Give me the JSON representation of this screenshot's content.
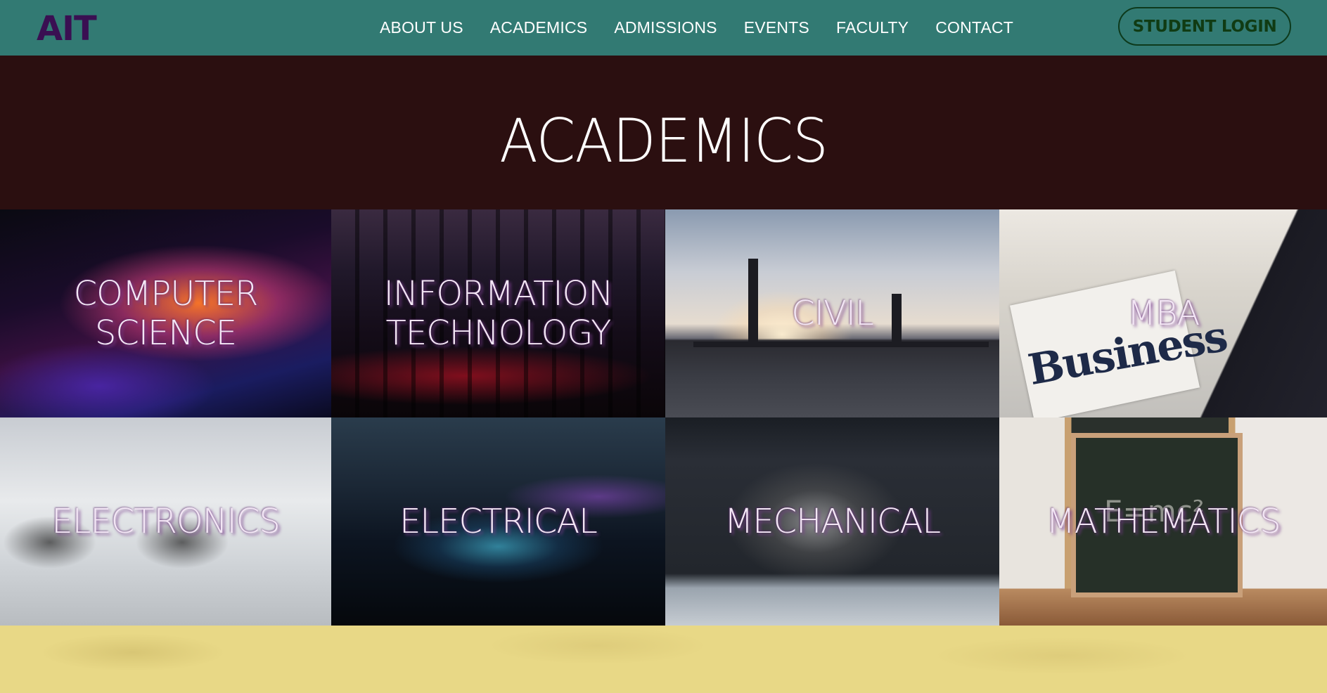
{
  "brand": {
    "logo_text": "AIT"
  },
  "nav": {
    "items": [
      {
        "label": "ABOUT US"
      },
      {
        "label": "ACADEMICS"
      },
      {
        "label": "ADMISSIONS"
      },
      {
        "label": "EVENTS"
      },
      {
        "label": "FACULTY"
      },
      {
        "label": "CONTACT"
      }
    ],
    "login_label": "STUDENT LOGIN"
  },
  "hero": {
    "title": "ACADEMICS"
  },
  "tiles": [
    {
      "label": "COMPUTER\nSCIENCE"
    },
    {
      "label": "INFORMATION\nTECHNOLOGY"
    },
    {
      "label": "CIVIL"
    },
    {
      "label": "MBA"
    },
    {
      "label": "ELECTRONICS"
    },
    {
      "label": "ELECTRICAL"
    },
    {
      "label": "MECHANICAL"
    },
    {
      "label": "MATHEMATICS"
    }
  ],
  "images": {
    "mba_newspaper_word": "Business",
    "math_board_text": "E=mc²"
  },
  "colors": {
    "navbar_bg": "#327a73",
    "logo": "#3a0f52",
    "hero_bg": "#2b0f10",
    "login_border": "#0d3a1c",
    "bottom_band": "#e8d886"
  }
}
